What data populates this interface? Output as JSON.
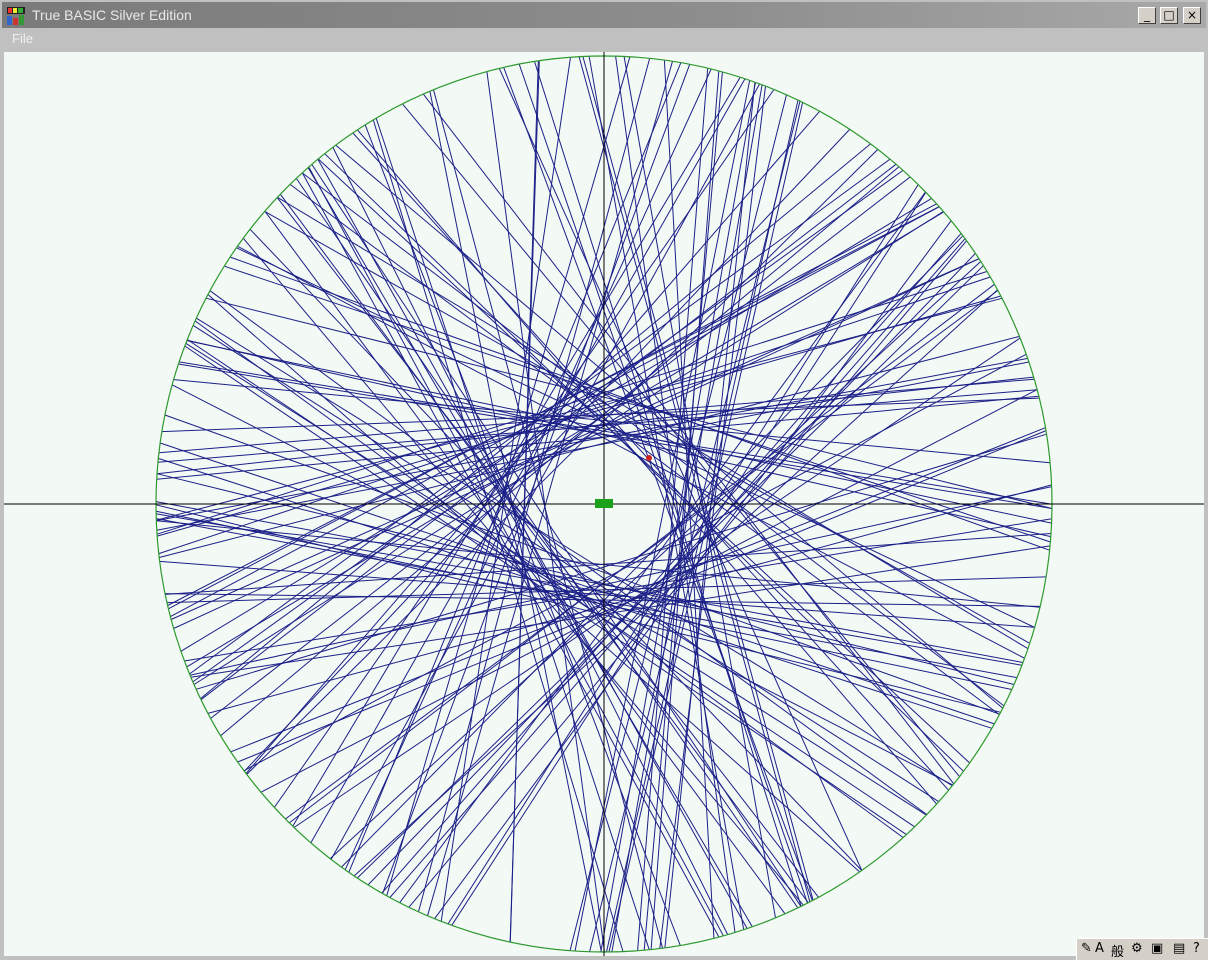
{
  "window": {
    "title": "True BASIC Silver Edition",
    "controls": {
      "minimize": "_",
      "maximize": "□",
      "close": "×"
    }
  },
  "menu": {
    "items": [
      {
        "label": "File"
      }
    ]
  },
  "icons": {
    "app": "true-basic-app-icon",
    "tray": [
      "pen-icon",
      "A",
      "般",
      "settings-icon",
      "book-icon",
      "notes-icon",
      "help-icon"
    ]
  },
  "colors": {
    "canvas_bg": "#f3f9f5",
    "circle": "#2e9a2e",
    "chords": "#1c2088",
    "axes": "#000000",
    "center_marker": "#1aa31a",
    "red_dot": "#cc2222"
  },
  "drawing": {
    "chord_count": 150,
    "seed": 7
  }
}
